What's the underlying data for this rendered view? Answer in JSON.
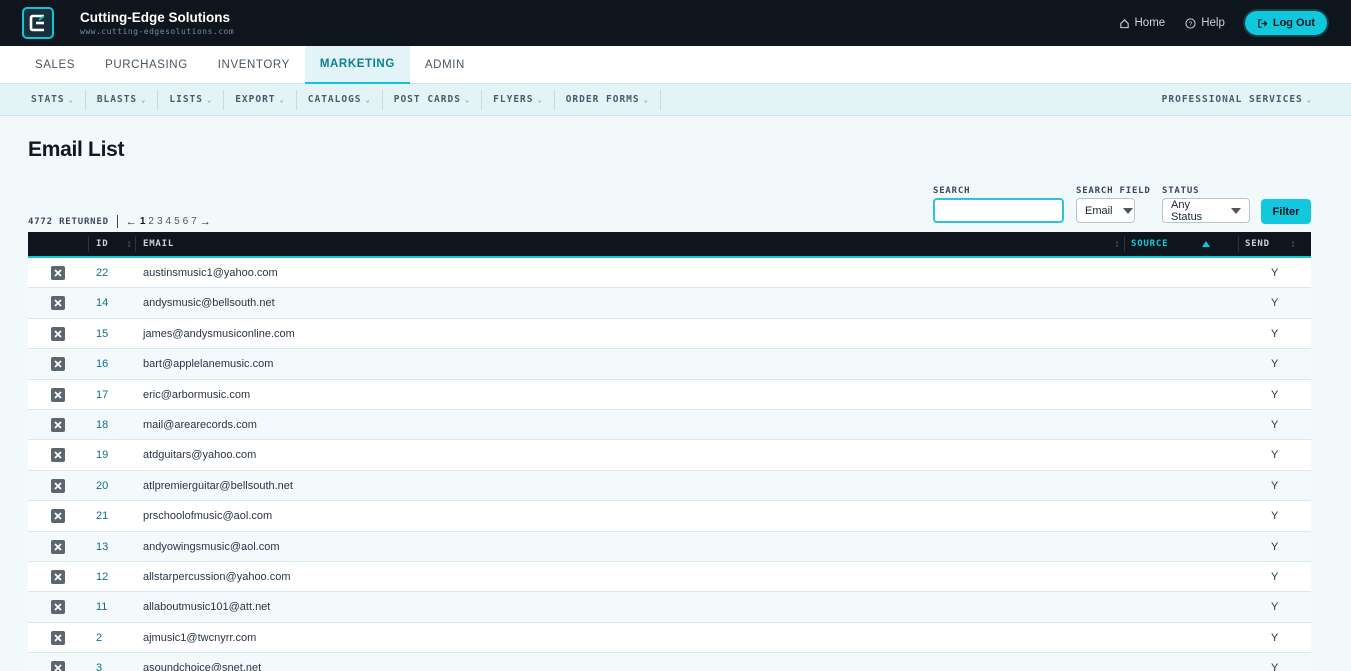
{
  "header": {
    "brand_name": "Cutting-Edge Solutions",
    "brand_url": "www.cutting-edgesolutions.com",
    "home_label": "Home",
    "help_label": "Help",
    "logout_label": "Log Out"
  },
  "main_nav": {
    "tabs": [
      {
        "label": "SALES"
      },
      {
        "label": "PURCHASING"
      },
      {
        "label": "INVENTORY"
      },
      {
        "label": "MARKETING",
        "active": true
      },
      {
        "label": "ADMIN"
      }
    ]
  },
  "sub_nav": {
    "items": [
      {
        "label": "STATS"
      },
      {
        "label": "BLASTS"
      },
      {
        "label": "LISTS"
      },
      {
        "label": "EXPORT"
      },
      {
        "label": "CATALOGS"
      },
      {
        "label": "POST CARDS"
      },
      {
        "label": "FLYERS"
      },
      {
        "label": "ORDER FORMS"
      }
    ],
    "right_item": "PROFESSIONAL SERVICES"
  },
  "page": {
    "title": "Email List",
    "returned_text": "4772 RETURNED",
    "pages": [
      "1",
      "2",
      "3",
      "4",
      "5",
      "6",
      "7"
    ],
    "current_page": "1"
  },
  "filters": {
    "search_label": "SEARCH",
    "search_value": "",
    "search_field_label": "SEARCH FIELD",
    "search_field_value": "Email",
    "status_label": "STATUS",
    "status_value": "Any Status",
    "filter_button": "Filter"
  },
  "table": {
    "columns": {
      "id": "ID",
      "email": "EMAIL",
      "source": "SOURCE",
      "send": "SEND"
    },
    "sorted_column": "SOURCE",
    "rows": [
      {
        "id": "22",
        "email": "austinsmusic1@yahoo.com",
        "send": "Y"
      },
      {
        "id": "14",
        "email": "andysmusic@bellsouth.net",
        "send": "Y"
      },
      {
        "id": "15",
        "email": "james@andysmusiconline.com",
        "send": "Y"
      },
      {
        "id": "16",
        "email": "bart@applelanemusic.com",
        "send": "Y"
      },
      {
        "id": "17",
        "email": "eric@arbormusic.com",
        "send": "Y"
      },
      {
        "id": "18",
        "email": "mail@arearecords.com",
        "send": "Y"
      },
      {
        "id": "19",
        "email": "atdguitars@yahoo.com",
        "send": "Y"
      },
      {
        "id": "20",
        "email": "atlpremierguitar@bellsouth.net",
        "send": "Y"
      },
      {
        "id": "21",
        "email": "prschoolofmusic@aol.com",
        "send": "Y"
      },
      {
        "id": "13",
        "email": "andyowingsmusic@aol.com",
        "send": "Y"
      },
      {
        "id": "12",
        "email": "allstarpercussion@yahoo.com",
        "send": "Y"
      },
      {
        "id": "11",
        "email": "allaboutmusic101@att.net",
        "send": "Y"
      },
      {
        "id": "2",
        "email": "ajmusic1@twcnyrr.com",
        "send": "Y"
      },
      {
        "id": "3",
        "email": "asoundchoice@snet.net",
        "send": "Y"
      }
    ]
  },
  "colors": {
    "accent": "#11c7dc",
    "header_bg": "#0f151d",
    "page_bg": "#f1f9fb"
  }
}
